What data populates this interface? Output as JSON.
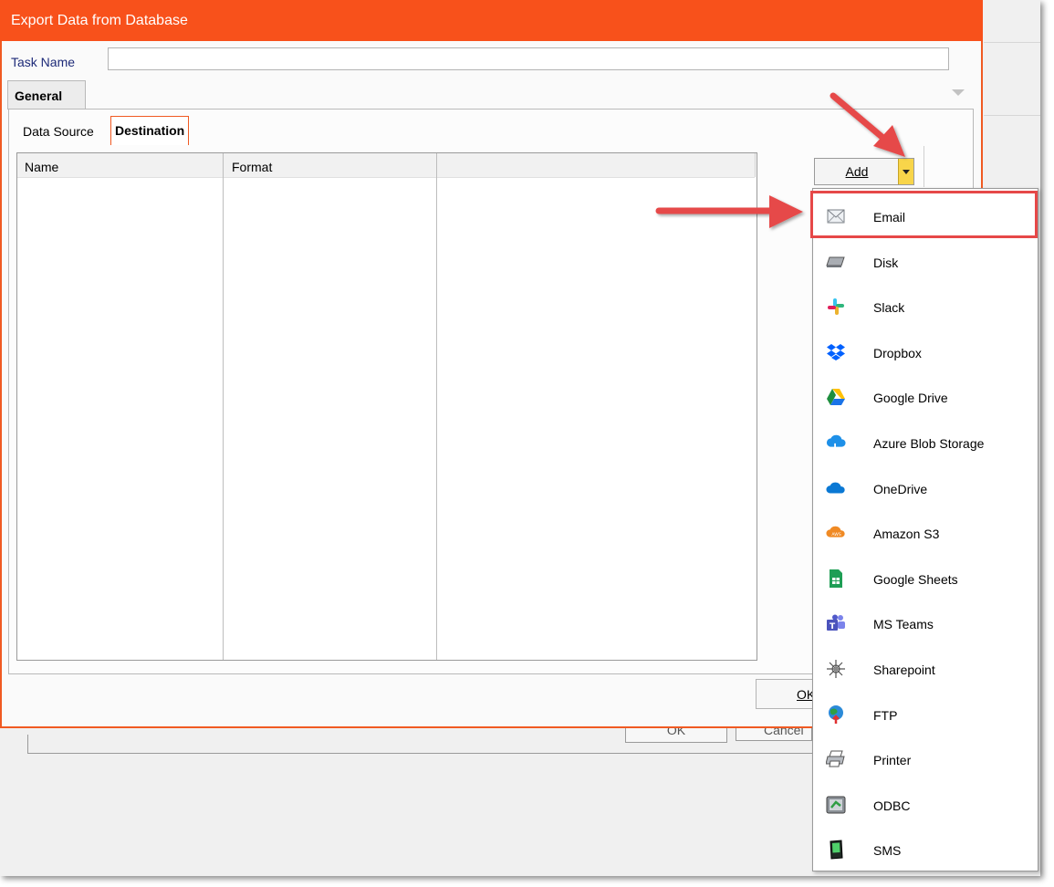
{
  "background_window": {
    "ok_label": "OK",
    "cancel_label": "Cancel"
  },
  "dialog": {
    "title": "Export Data from Database",
    "task_name_label": "Task Name",
    "task_name_value": "",
    "tab_general": "General",
    "subtab_data_source": "Data Source",
    "subtab_destination": "Destination",
    "columns": [
      "Name",
      "Format",
      ""
    ],
    "add_label": "Add",
    "ok_label": "OK"
  },
  "menu": {
    "items": [
      {
        "label": "Email",
        "icon": "envelope-icon",
        "highlighted": true
      },
      {
        "label": "Disk",
        "icon": "hard-disk-icon"
      },
      {
        "label": "Slack",
        "icon": "slack-icon"
      },
      {
        "label": "Dropbox",
        "icon": "dropbox-icon"
      },
      {
        "label": "Google Drive",
        "icon": "google-drive-icon"
      },
      {
        "label": "Azure Blob Storage",
        "icon": "azure-cloud-icon"
      },
      {
        "label": "OneDrive",
        "icon": "onedrive-icon"
      },
      {
        "label": "Amazon S3",
        "icon": "amazon-s3-icon"
      },
      {
        "label": "Google Sheets",
        "icon": "google-sheets-icon"
      },
      {
        "label": "MS Teams",
        "icon": "ms-teams-icon"
      },
      {
        "label": "Sharepoint",
        "icon": "sharepoint-icon"
      },
      {
        "label": "FTP",
        "icon": "ftp-globe-icon"
      },
      {
        "label": "Printer",
        "icon": "printer-icon"
      },
      {
        "label": "ODBC",
        "icon": "odbc-icon"
      },
      {
        "label": "SMS",
        "icon": "sms-phone-icon"
      }
    ]
  },
  "colors": {
    "titlebar": "#f8511b",
    "highlight_box": "#e64848",
    "arrow": "#e64848"
  }
}
